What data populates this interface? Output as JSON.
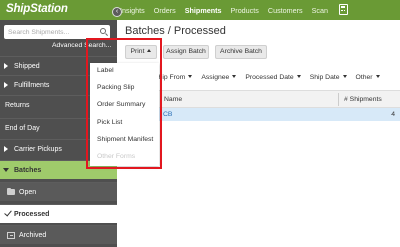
{
  "header": {
    "logo": "ShipStation",
    "nav": [
      "Insights",
      "Orders",
      "Shipments",
      "Products",
      "Customers",
      "Scan"
    ],
    "active_nav": "Shipments",
    "accent_color": "#6a9a35"
  },
  "sidebar": {
    "search_placeholder": "Search Shipments...",
    "advanced_search": "Advanced Search...",
    "items": [
      {
        "label": "Shipped"
      },
      {
        "label": "Fulfillments"
      },
      {
        "label": "Returns"
      },
      {
        "label": "End of Day"
      },
      {
        "label": "Carrier Pickups"
      },
      {
        "label": "Batches"
      }
    ],
    "batches_sub": [
      {
        "label": "Open"
      },
      {
        "label": "Processed"
      },
      {
        "label": "Archived"
      }
    ]
  },
  "main": {
    "title": "Batches / Processed",
    "print_label": "Print",
    "assign_batch": "Assign Batch",
    "archive_batch": "Archive Batch",
    "filters": [
      "Ship From",
      "Assignee",
      "Processed Date",
      "Ship Date",
      "Other"
    ],
    "columns": [
      "Name",
      "# Shipments"
    ],
    "rows": [
      {
        "name": "CB",
        "shipments": "4"
      }
    ]
  },
  "print_menu": {
    "items": [
      "Label",
      "Packing Slip",
      "Order Summary",
      "Pick List",
      "Shipment Manifest"
    ],
    "disabled_item": "Other Forms"
  }
}
